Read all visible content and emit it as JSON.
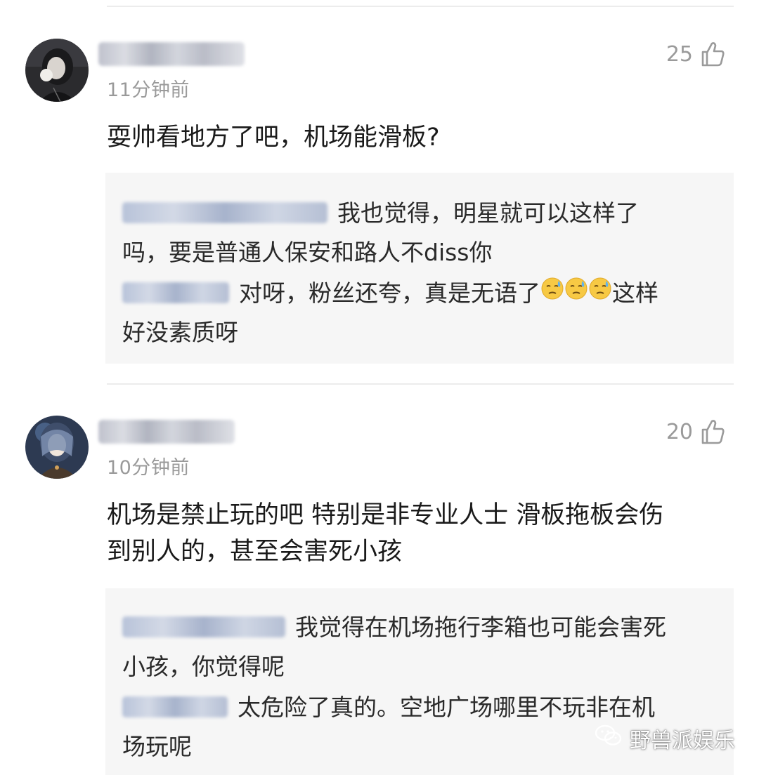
{
  "comments": [
    {
      "time": "11分钟前",
      "likes": "25",
      "text": "耍帅看地方了吧，机场能滑板?",
      "replies": [
        {
          "text_line1": "我也觉得，明星就可以这样了",
          "text_line2": "吗，要是普通人保安和路人不diss你"
        },
        {
          "text_line1": "对呀，粉丝还夸，真是无语了",
          "text_after_emoji": "这样",
          "text_line2": "好没素质呀",
          "emoji": "sweat-face-emoji"
        }
      ]
    },
    {
      "time": "10分钟前",
      "likes": "20",
      "text_line1": "机场是禁止玩的吧 特别是非专业人士 滑板拖板会伤",
      "text_line2": "到别人的，甚至会害死小孩",
      "replies": [
        {
          "text_line1": "我觉得在机场拖行李箱也可能会害死",
          "text_line2": "小孩，你觉得呢"
        },
        {
          "text_line1": "太危险了真的。空地广场哪里不玩非在机",
          "text_line2": "场玩呢"
        }
      ]
    }
  ],
  "watermark": {
    "text": "野兽派娱乐",
    "icon": "wechat-icon"
  },
  "icons": {
    "like": "thumbs-up-icon"
  },
  "colors": {
    "meta_text": "#9a9a9a",
    "body_text": "#1a1a1a",
    "reply_bg": "#f6f6f6",
    "divider": "#ececec"
  }
}
